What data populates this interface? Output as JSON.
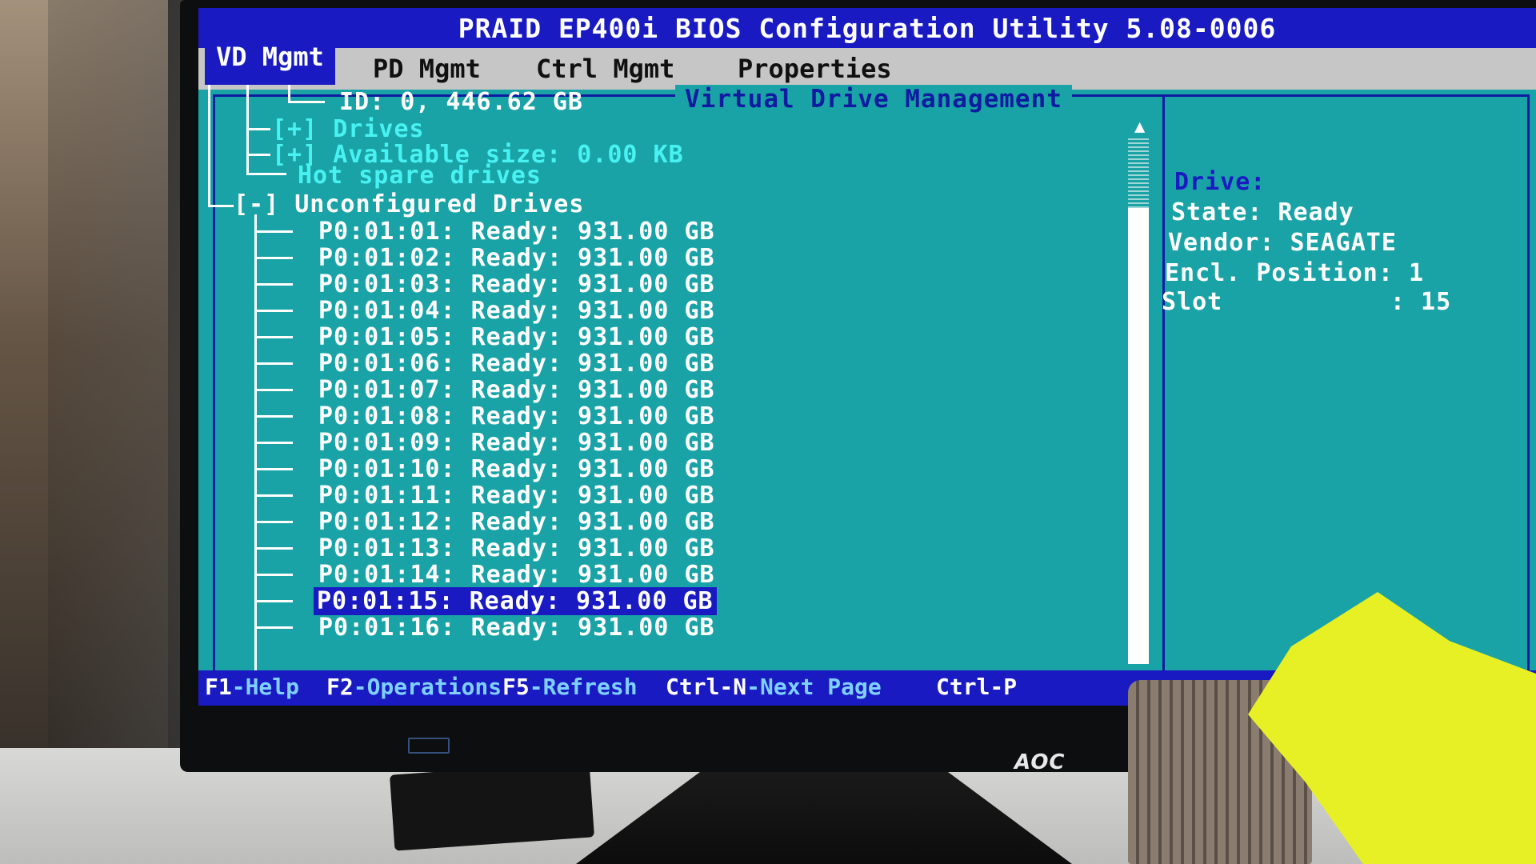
{
  "monitor": {
    "brand": "AOC"
  },
  "bios": {
    "title": "PRAID EP400i BIOS Configuration Utility 5.08-0006",
    "tabs": [
      {
        "label": "VD Mgmt",
        "active": true
      },
      {
        "label": "PD Mgmt",
        "active": false
      },
      {
        "label": "Ctrl Mgmt",
        "active": false
      },
      {
        "label": "Properties",
        "active": false
      }
    ],
    "panel_title": "Virtual Drive Management",
    "tree": {
      "vd_entry": "ID: 0, 446.62 GB",
      "drives_node": "[+] Drives",
      "available_node": "[+] Available size: 0.00 KB",
      "hot_spare": "Hot spare drives",
      "unconfigured": "[-] Unconfigured Drives",
      "drives": [
        "P0:01:01: Ready: 931.00 GB",
        "P0:01:02: Ready: 931.00 GB",
        "P0:01:03: Ready: 931.00 GB",
        "P0:01:04: Ready: 931.00 GB",
        "P0:01:05: Ready: 931.00 GB",
        "P0:01:06: Ready: 931.00 GB",
        "P0:01:07: Ready: 931.00 GB",
        "P0:01:08: Ready: 931.00 GB",
        "P0:01:09: Ready: 931.00 GB",
        "P0:01:10: Ready: 931.00 GB",
        "P0:01:11: Ready: 931.00 GB",
        "P0:01:12: Ready: 931.00 GB",
        "P0:01:13: Ready: 931.00 GB",
        "P0:01:14: Ready: 931.00 GB",
        "P0:01:15: Ready: 931.00 GB",
        "P0:01:16: Ready: 931.00 GB"
      ],
      "selected_index": 14
    },
    "info": {
      "drive_label": "Drive:",
      "state": "State: Ready",
      "vendor": "Vendor: SEAGATE",
      "encl_position": "Encl. Position: 1",
      "slot": "Slot           : 15"
    },
    "footer": [
      {
        "key": "F1",
        "desc": "-Help"
      },
      {
        "key": "F2",
        "desc": "-Operations"
      },
      {
        "key": "F5",
        "desc": "-Refresh"
      },
      {
        "key": "Ctrl-N",
        "desc": "-Next Page"
      },
      {
        "key": "Ctrl-P",
        "desc": ""
      }
    ],
    "colors": {
      "screen_bg": "#1aa3a6",
      "bar_blue": "#1a1ac2",
      "tab_bar": "#c6c6c6",
      "highlight_text": "#48f2f2"
    }
  }
}
